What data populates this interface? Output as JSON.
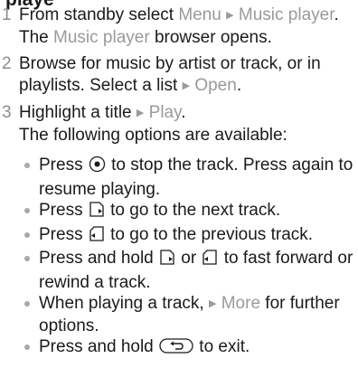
{
  "heading_clip": "playe",
  "steps": [
    {
      "num": "1",
      "t1": "From standby select ",
      "hl1": "Menu",
      "hl2": "Music player",
      "t2": ". The ",
      "hl3": "Music player",
      "t3": " browser opens."
    },
    {
      "num": "2",
      "t1": "Browse for music by artist or track, or in playlists. Select a list ",
      "hl1": "Open",
      "t2": "."
    },
    {
      "num": "3",
      "t1": "Highlight a title ",
      "hl1": "Play",
      "t2": ".",
      "sub": "The following options are available:"
    }
  ],
  "bullets": [
    {
      "a": "Press ",
      "icon": "center-select-key-icon",
      "b": " to stop the track. Press again to resume playing."
    },
    {
      "a": "Press ",
      "icon": "next-track-key-icon",
      "b": " to go to the next track."
    },
    {
      "a": "Press ",
      "icon": "previous-track-key-icon",
      "b": " to go to the previous track."
    },
    {
      "a": "Press and hold ",
      "icon1": "next-track-key-icon",
      "mid": " or ",
      "icon2": "previous-track-key-icon",
      "b": " to fast forward or rewind a track."
    },
    {
      "a": "When playing a track, ",
      "hl": "More",
      "b": " for further options."
    },
    {
      "a": "Press and hold ",
      "icon": "back-key-icon",
      "b": " to exit."
    }
  ],
  "arrow_glyph": "▶",
  "colors": {
    "highlight": "#9a9a9a",
    "text": "#1a1a1a",
    "bullet": "#a8a8a8"
  }
}
